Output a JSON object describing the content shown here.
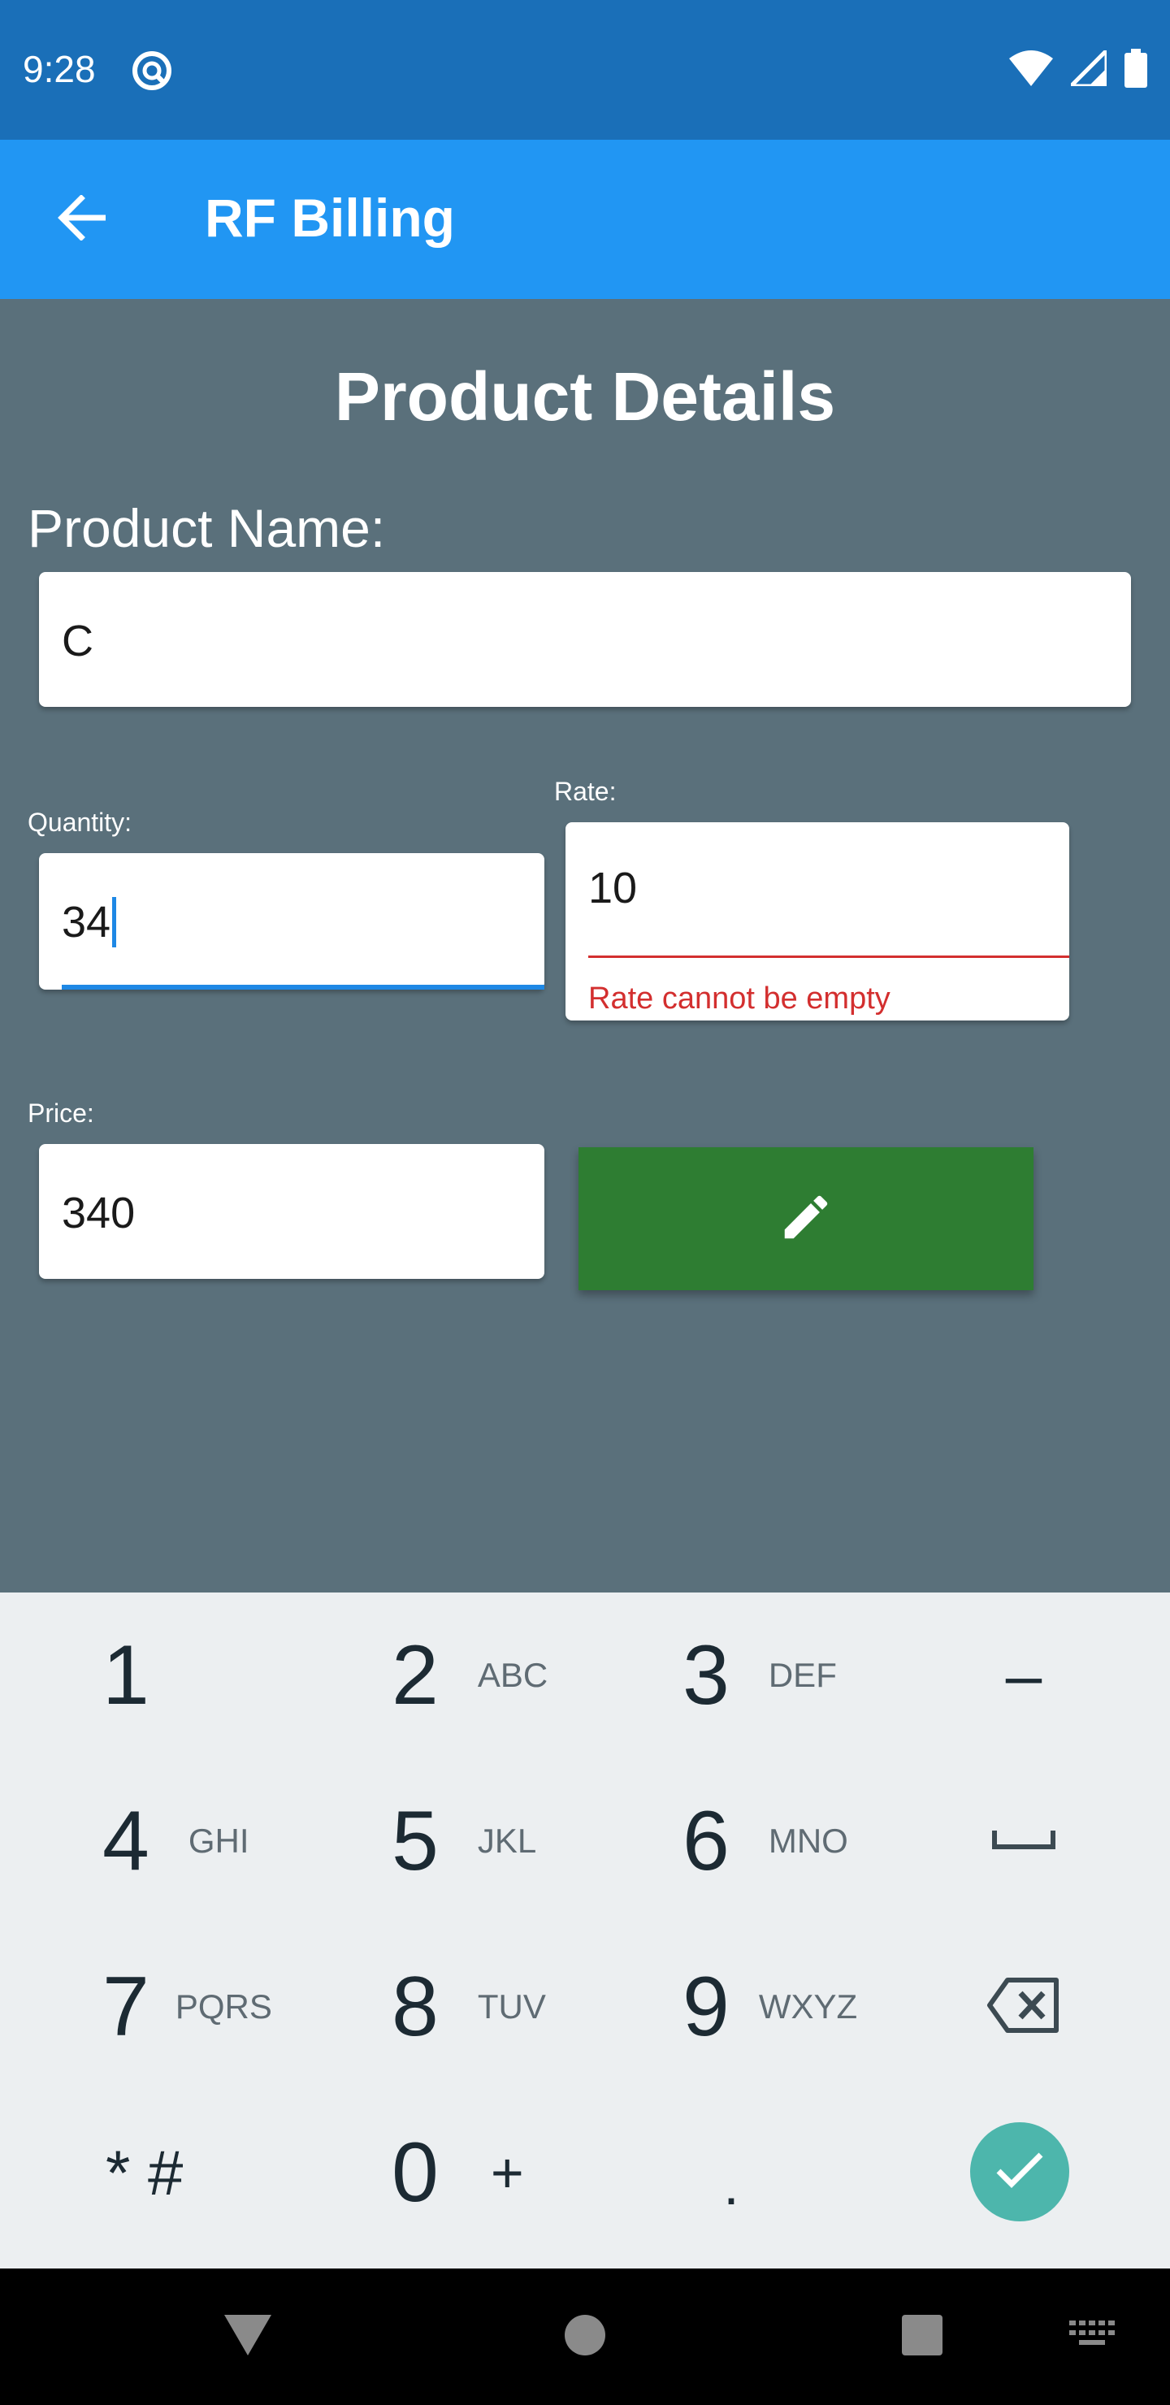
{
  "status_bar": {
    "time": "9:28",
    "icons": [
      "sync-icon",
      "wifi-icon",
      "signal-icon",
      "battery-icon"
    ]
  },
  "app_bar": {
    "title": "RF Billing",
    "back_icon": "arrow-back-icon",
    "color": "#2196f3"
  },
  "form": {
    "title": "Product Details",
    "product_name": {
      "label": "Product Name:",
      "value": "C"
    },
    "quantity": {
      "label": "Quantity:",
      "value": "34"
    },
    "rate": {
      "label": "Rate:",
      "value": "10",
      "error": "Rate cannot be empty"
    },
    "price": {
      "label": "Price:",
      "value": "340"
    },
    "edit_button": {
      "icon": "pencil-icon",
      "color": "#2e7d32"
    }
  },
  "keyboard": {
    "rows": [
      [
        {
          "num": "1",
          "letters": ""
        },
        {
          "num": "2",
          "letters": "ABC"
        },
        {
          "num": "3",
          "letters": "DEF"
        },
        {
          "num": "–",
          "letters": ""
        }
      ],
      [
        {
          "num": "4",
          "letters": "GHI"
        },
        {
          "num": "5",
          "letters": "JKL"
        },
        {
          "num": "6",
          "letters": "MNO"
        },
        {
          "num": "space",
          "letters": ""
        }
      ],
      [
        {
          "num": "7",
          "letters": "PQRS"
        },
        {
          "num": "8",
          "letters": "TUV"
        },
        {
          "num": "9",
          "letters": "WXYZ"
        },
        {
          "num": "backspace",
          "letters": ""
        }
      ],
      [
        {
          "num": "* #",
          "letters": ""
        },
        {
          "num": "0",
          "letters": "+"
        },
        {
          "num": ".",
          "letters": ""
        },
        {
          "num": "done",
          "letters": ""
        }
      ]
    ]
  },
  "nav_bar": {
    "icons": [
      "back-triangle-icon",
      "home-circle-icon",
      "recents-square-icon",
      "keyboard-icon"
    ]
  }
}
